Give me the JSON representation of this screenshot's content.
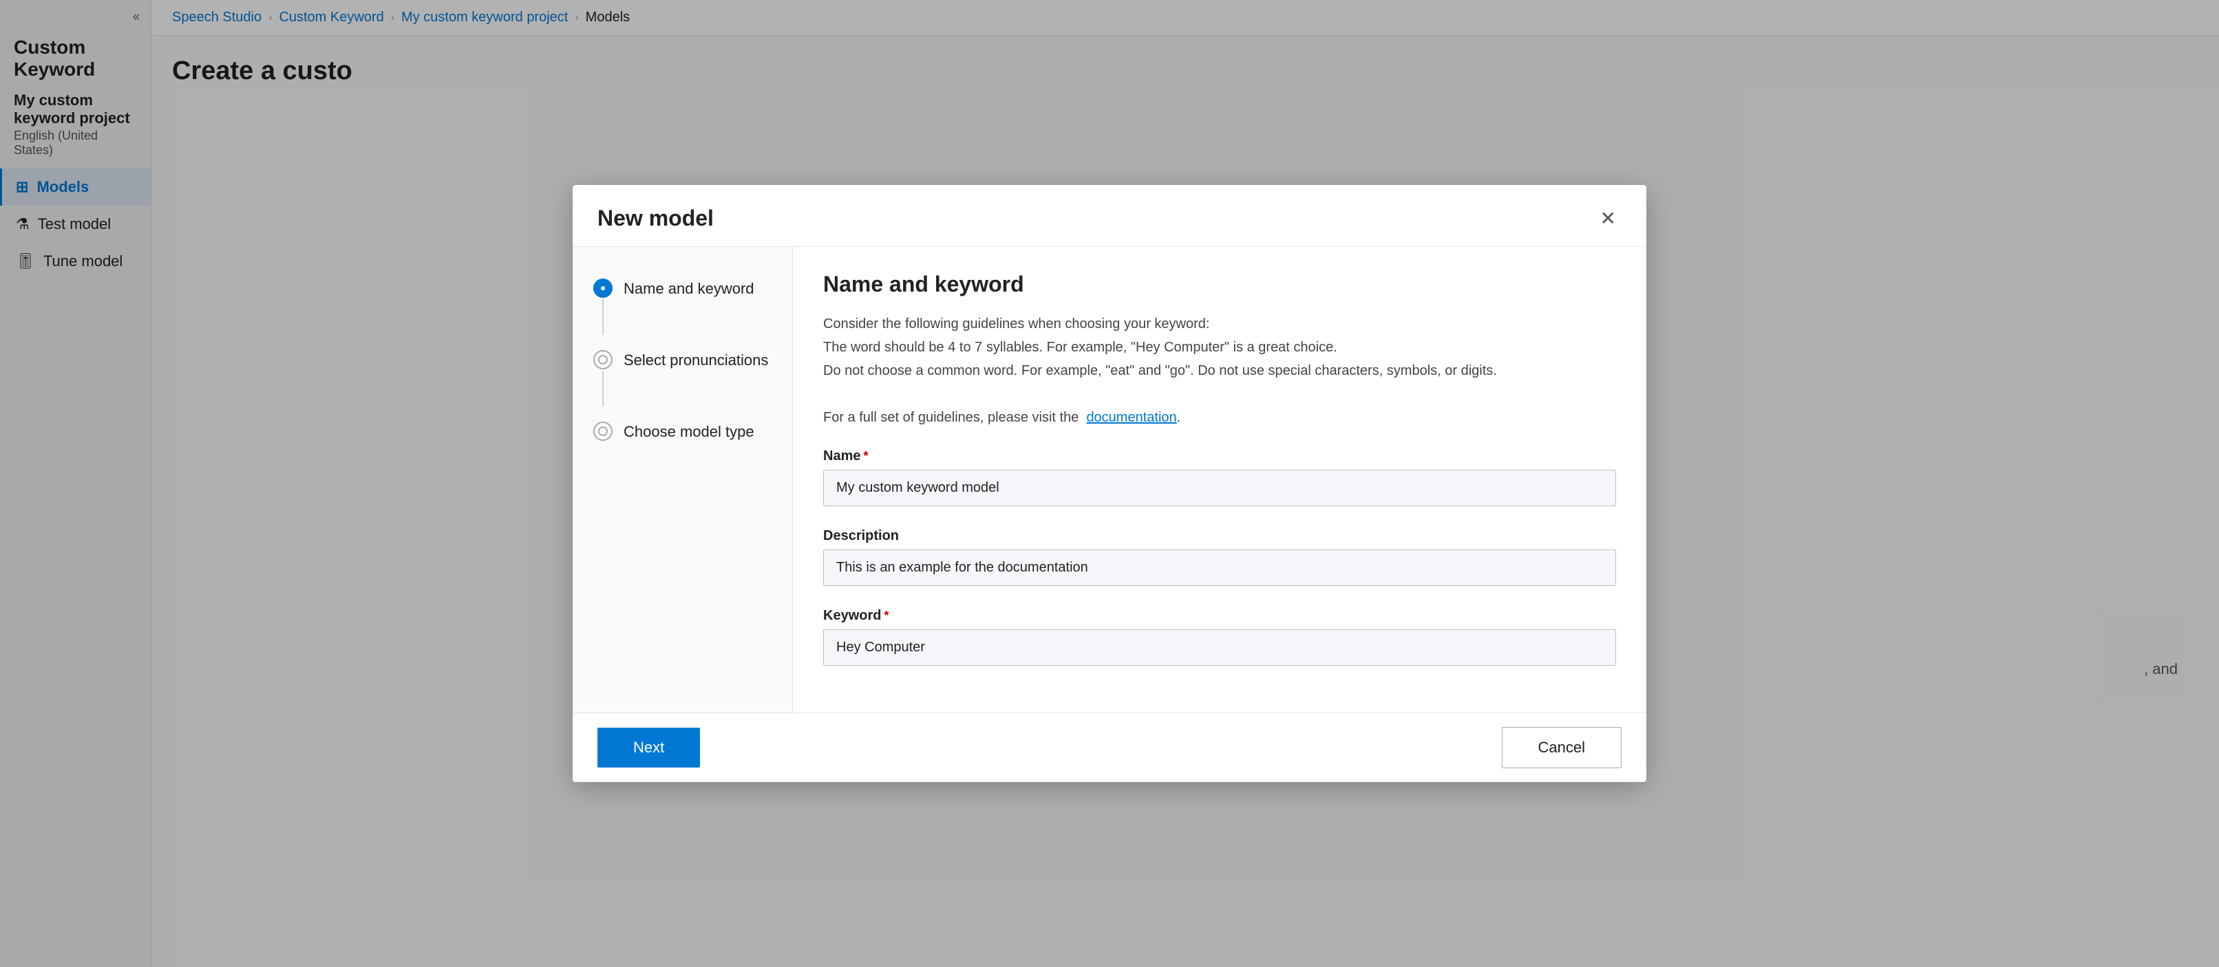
{
  "app": {
    "title": "Speech Studio",
    "collapse_icon": "«"
  },
  "sidebar": {
    "title": "Custom Keyword",
    "project_name": "My custom keyword project",
    "project_lang": "English (United States)",
    "nav_items": [
      {
        "id": "models",
        "label": "Models",
        "icon": "⊞",
        "active": true
      },
      {
        "id": "test-model",
        "label": "Test model",
        "icon": "⚗",
        "active": false
      },
      {
        "id": "tune-model",
        "label": "Tune model",
        "icon": "🎚",
        "active": false
      }
    ]
  },
  "breadcrumb": {
    "items": [
      {
        "label": "Speech Studio",
        "href": true
      },
      {
        "label": "Custom Keyword",
        "href": true
      },
      {
        "label": "My custom keyword project",
        "href": true
      },
      {
        "label": "Models",
        "href": false
      }
    ],
    "separator": "›"
  },
  "page": {
    "title": "Create a custo"
  },
  "modal": {
    "title": "New model",
    "close_icon": "✕",
    "wizard_steps": [
      {
        "id": "name-and-keyword",
        "label": "Name and keyword",
        "active": true,
        "has_line": true
      },
      {
        "id": "select-pronunciations",
        "label": "Select pronunciations",
        "active": false,
        "has_line": true
      },
      {
        "id": "choose-model-type",
        "label": "Choose model type",
        "active": false,
        "has_line": false
      }
    ],
    "content": {
      "title": "Name and keyword",
      "guidelines": "Consider the following guidelines when choosing your keyword:\nThe word should be 4 to 7 syllables. For example, \"Hey Computer\" is a great choice.\nDo not choose a common word. For example, \"eat\" and \"go\". Do not use special characters, symbols, or digits.",
      "guidelines_link_text": "For a full set of guidelines, please visit the",
      "documentation_label": "documentation",
      "name_label": "Name",
      "name_required": "★",
      "name_value": "My custom keyword model",
      "description_label": "Description",
      "description_value": "This is an example for the documentation",
      "keyword_label": "Keyword",
      "keyword_required": "★",
      "keyword_value": "Hey Computer"
    },
    "footer": {
      "next_label": "Next",
      "cancel_label": "Cancel"
    }
  },
  "background_text": ", and"
}
